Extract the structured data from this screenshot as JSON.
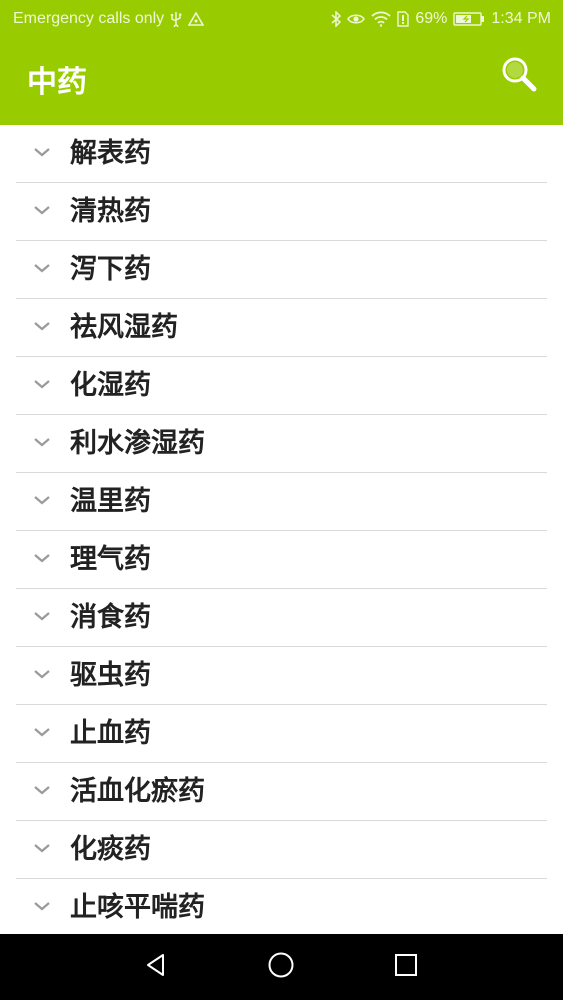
{
  "status_bar": {
    "carrier": "Emergency calls only",
    "battery": "69%",
    "time": "1:34 PM",
    "icons": [
      "usb-icon",
      "signal-icon",
      "bluetooth-icon",
      "eye-icon",
      "wifi-icon",
      "sim-icon",
      "battery-icon"
    ]
  },
  "app_bar": {
    "title": "中药",
    "search_icon": "search-icon",
    "background": "#99cc00"
  },
  "categories": [
    {
      "label": "解表药"
    },
    {
      "label": "清热药"
    },
    {
      "label": "泻下药"
    },
    {
      "label": "祛风湿药"
    },
    {
      "label": "化湿药"
    },
    {
      "label": "利水渗湿药"
    },
    {
      "label": "温里药"
    },
    {
      "label": "理气药"
    },
    {
      "label": "消食药"
    },
    {
      "label": "驱虫药"
    },
    {
      "label": "止血药"
    },
    {
      "label": "活血化瘀药"
    },
    {
      "label": "化痰药"
    },
    {
      "label": "止咳平喘药"
    }
  ],
  "nav_bar": {
    "icons": [
      "back-icon",
      "home-icon",
      "recents-icon"
    ]
  }
}
